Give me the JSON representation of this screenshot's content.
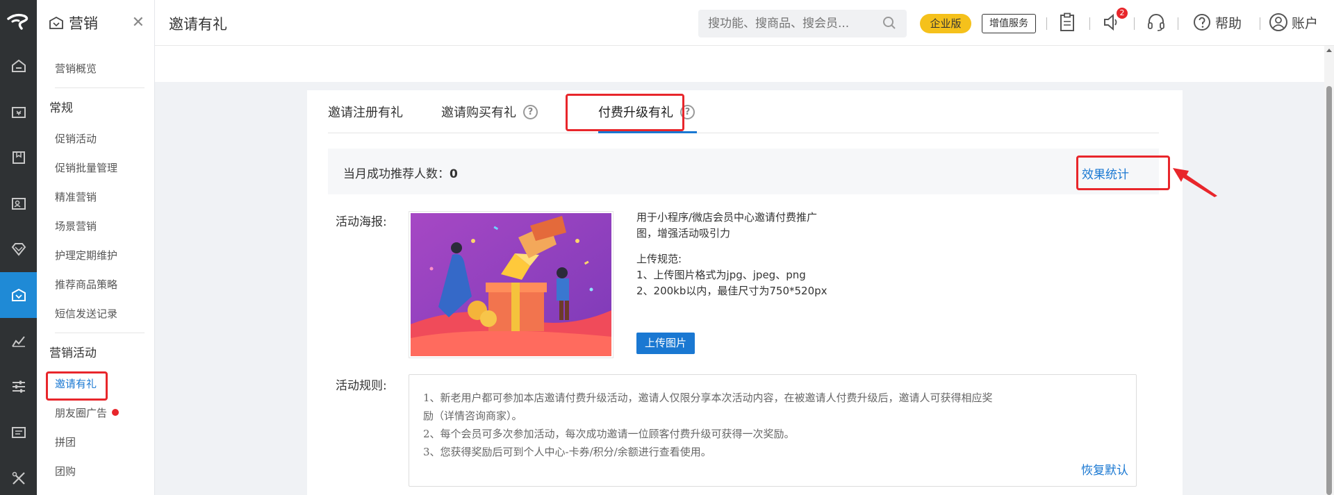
{
  "rail": {
    "items": [
      {
        "icon": "home-icon"
      },
      {
        "icon": "store-icon"
      },
      {
        "icon": "box-icon"
      },
      {
        "icon": "member-card-icon"
      },
      {
        "icon": "diamond-icon"
      },
      {
        "icon": "marketing-icon",
        "active": true
      },
      {
        "icon": "chart-icon"
      },
      {
        "icon": "sliders-icon"
      },
      {
        "icon": "coupon-icon"
      },
      {
        "icon": "tools-icon"
      }
    ]
  },
  "submenu": {
    "title": "营销",
    "overview": "营销概览",
    "group1": "常规",
    "group1_items": [
      "促销活动",
      "促销批量管理",
      "精准营销",
      "场景营销",
      "护理定期维护",
      "推荐商品策略",
      "短信发送记录"
    ],
    "group2": "营销活动",
    "group2_items": [
      "邀请有礼",
      "朋友圈广告",
      "拼团",
      "团购"
    ]
  },
  "header": {
    "page_title": "邀请有礼",
    "search_placeholder": "搜功能、搜商品、搜会员...",
    "edition_badge": "企业版",
    "vas_button": "增值服务",
    "notification_count": "2",
    "help": "帮助",
    "account": "账户"
  },
  "tabs": [
    {
      "label": "邀请注册有礼"
    },
    {
      "label": "邀请购买有礼"
    },
    {
      "label": "付费升级有礼",
      "active": true
    }
  ],
  "stats": {
    "label": "当月成功推荐人数：",
    "value": "0",
    "link": "效果统计"
  },
  "poster": {
    "label": "活动海报:",
    "desc_line1": "用于小程序/微店会员中心邀请付费推广",
    "desc_line2": "图，增强活动吸引力",
    "spec_title": "上传规范:",
    "spec_1": "1、上传图片格式为jpg、jpeg、png",
    "spec_2": "2、200kb以内，最佳尺寸为750*520px",
    "upload_button": "上传图片"
  },
  "rules": {
    "label": "活动规则:",
    "line1": "1、新老用户都可参加本店邀请付费升级活动，邀请人仅限分享本次活动内容，在被邀请人付费升级后，邀请人可获得相应奖",
    "line2": "励（详情咨询商家）。",
    "line3": "2、每个会员可多次参加活动，每次成功邀请一位顾客付费升级可获得一次奖励。",
    "line4": "3、您获得奖励后可到个人中心-卡券/积分/余额进行查看使用。",
    "reset": "恢复默认"
  },
  "colors": {
    "primary": "#1a78d2",
    "highlight": "#e8262b",
    "rail_bg": "#2f3234",
    "edition_badge": "#f5c11b"
  }
}
